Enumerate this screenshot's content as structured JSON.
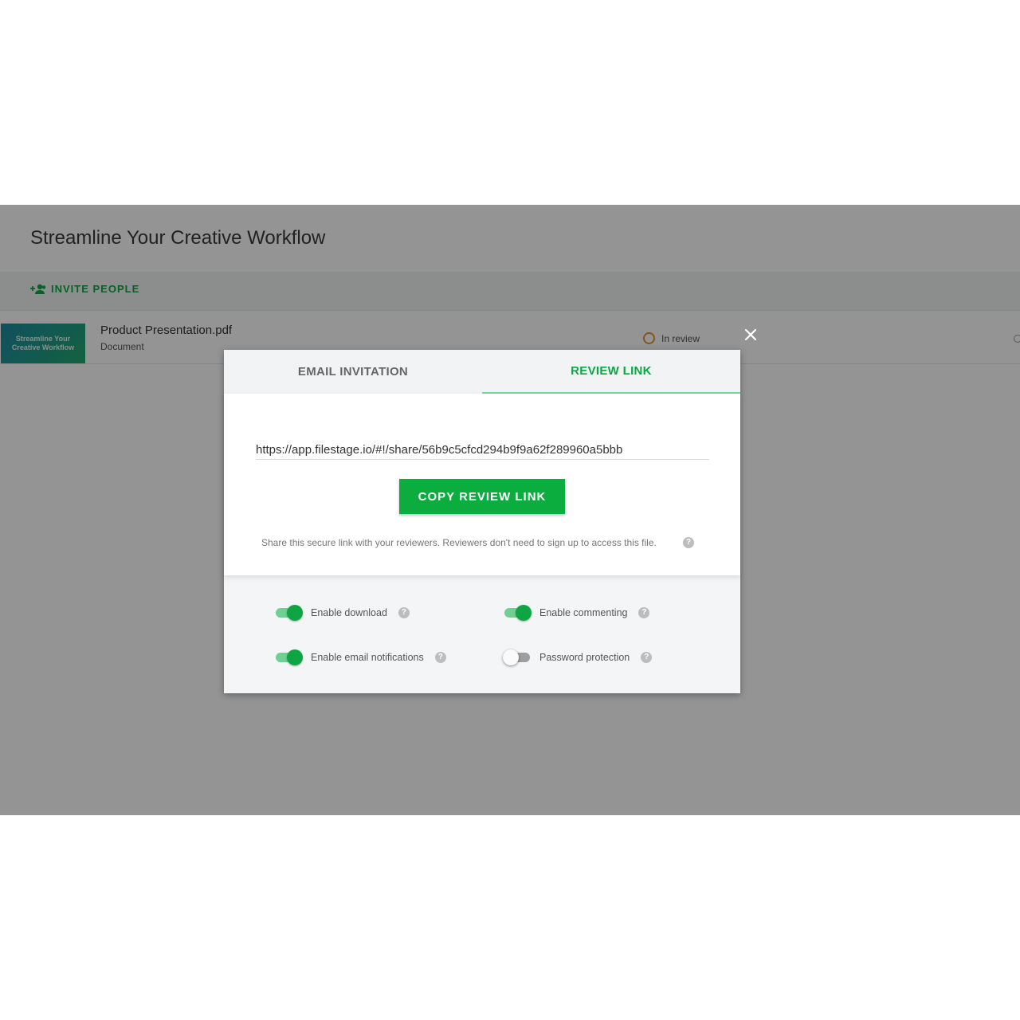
{
  "project": {
    "title": "Streamline Your Creative Workflow",
    "invite_label": "INVITE PEOPLE"
  },
  "file": {
    "name": "Product Presentation.pdf",
    "type": "Document",
    "thumbnail_text": "Streamline Your Creative Workflow",
    "status": "In review"
  },
  "modal": {
    "tabs": [
      {
        "label": "EMAIL INVITATION",
        "active": false
      },
      {
        "label": "REVIEW LINK",
        "active": true
      }
    ],
    "review_link": "https://app.filestage.io/#!/share/56b9c5cfcd294b9f9a62f289960a5bbb",
    "copy_button": "COPY REVIEW LINK",
    "hint": "Share this secure link with your reviewers. Reviewers don't need to sign up to access this file.",
    "help_glyph": "?",
    "close_glyph": "×",
    "options": [
      {
        "label": "Enable download",
        "enabled": true
      },
      {
        "label": "Enable commenting",
        "enabled": true
      },
      {
        "label": "Enable email notifications",
        "enabled": true
      },
      {
        "label": "Password protection",
        "enabled": false
      }
    ]
  },
  "colors": {
    "accent": "#0aad3e",
    "status_in_review": "#e8922a",
    "overlay": "rgba(0,0,0,0.42)"
  }
}
